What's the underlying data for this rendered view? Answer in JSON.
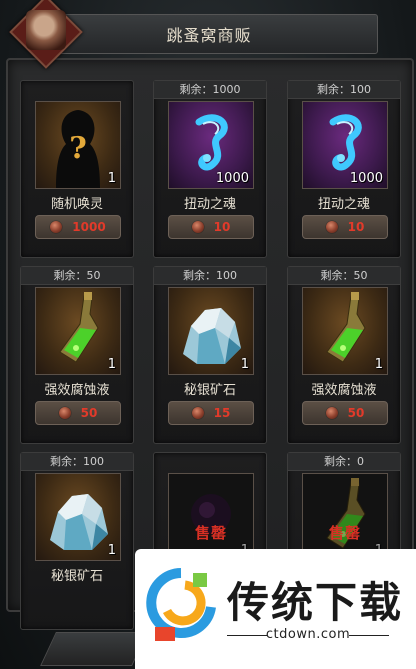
{
  "header": {
    "title": "跳蚤窝商贩"
  },
  "items": [
    {
      "remain": "",
      "name": "随机唤灵",
      "qty": "1",
      "price": "1000",
      "bg": "brown",
      "icon": "mystery-silhouette",
      "sold_out": false
    },
    {
      "remain": "剩余：1000",
      "name": "扭动之魂",
      "qty": "1000",
      "price": "10",
      "bg": "purple",
      "icon": "soul-wisp",
      "sold_out": false
    },
    {
      "remain": "剩余：100",
      "name": "扭动之魂",
      "qty": "1000",
      "price": "10",
      "bg": "purple",
      "icon": "soul-wisp",
      "sold_out": false
    },
    {
      "remain": "剩余：50",
      "name": "强效腐蚀液",
      "qty": "1",
      "price": "50",
      "bg": "brown",
      "icon": "potion-flask",
      "sold_out": false
    },
    {
      "remain": "剩余：100",
      "name": "秘银矿石",
      "qty": "1",
      "price": "15",
      "bg": "brown",
      "icon": "mithril-ore",
      "sold_out": false
    },
    {
      "remain": "剩余：50",
      "name": "强效腐蚀液",
      "qty": "1",
      "price": "50",
      "bg": "brown",
      "icon": "potion-flask",
      "sold_out": false
    },
    {
      "remain": "剩余：100",
      "name": "秘银矿石",
      "qty": "1",
      "price": "",
      "bg": "brown",
      "icon": "mithril-ore",
      "sold_out": false
    },
    {
      "remain": "",
      "name": "",
      "qty": "1",
      "price": "",
      "bg": "dark",
      "icon": "dark-orb",
      "sold_out": true,
      "sold_text": "售罄"
    },
    {
      "remain": "剩余：0",
      "name": "",
      "qty": "1",
      "price": "",
      "bg": "dark",
      "icon": "potion-flask",
      "sold_out": true,
      "sold_text": "售罄"
    }
  ],
  "watermark": {
    "title": "传统下载",
    "url": "ctdown.com"
  },
  "colors": {
    "price_red": "#e23a2a",
    "sold_red": "#d83024"
  }
}
